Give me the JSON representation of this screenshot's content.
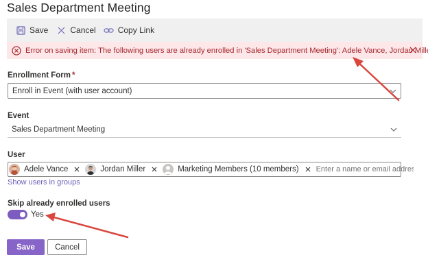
{
  "page": {
    "title": "Sales Department Meeting"
  },
  "toolbar": {
    "save_label": "Save",
    "cancel_label": "Cancel",
    "copy_link_label": "Copy Link"
  },
  "error": {
    "message": "Error on saving item: The following users are already enrolled in 'Sales Department Meeting': Adele Vance, Jordan Miller"
  },
  "form": {
    "enrollment_form": {
      "label": "Enrollment Form",
      "required_mark": "*",
      "value": "Enroll in Event (with user account)"
    },
    "event": {
      "label": "Event",
      "value": "Sales Department Meeting"
    },
    "user": {
      "label": "User",
      "selected": [
        {
          "name": "Adele Vance",
          "avatar": "photo",
          "color": "#c0604a"
        },
        {
          "name": "Jordan Miller",
          "avatar": "photo",
          "color": "#3b3b3b"
        },
        {
          "name": "Marketing Members (10 members)",
          "avatar": "group-placeholder",
          "color": "#b3b0ad"
        }
      ],
      "placeholder": "Enter a name or email address",
      "show_groups_link": "Show users in groups"
    },
    "skip_enrolled": {
      "label": "Skip already enrolled users",
      "toggle_value": "Yes",
      "on": true
    }
  },
  "actions": {
    "save_label": "Save",
    "cancel_label": "Cancel"
  },
  "colors": {
    "accent": "#8764c8",
    "error_text": "#a4262c",
    "error_bg": "#fde7e9",
    "annotation_arrow": "#d9473f"
  }
}
